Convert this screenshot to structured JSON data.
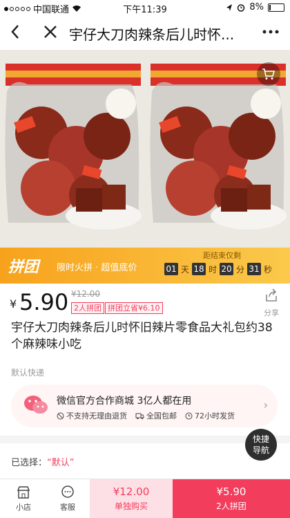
{
  "status_bar": {
    "carrier": "中国联通",
    "time": "下午11:39",
    "battery": "8%",
    "battery_level": 0.08
  },
  "nav": {
    "title": "宇仔大刀肉辣条后儿时怀..."
  },
  "promo": {
    "badge": "拼团",
    "subtitle": "限时火拼 · 超值底价",
    "countdown_title": "距结束仅剩",
    "countdown": [
      {
        "value": "01",
        "unit": "天"
      },
      {
        "value": "18",
        "unit": "时"
      },
      {
        "value": "20",
        "unit": "分"
      },
      {
        "value": "31",
        "unit": "秒"
      }
    ]
  },
  "price": {
    "currency": "¥",
    "current": "5.90",
    "original": "¥12.00",
    "tag_group": "2人拼团",
    "tag_save": "拼团立省¥6.10",
    "share_label": "分享"
  },
  "product": {
    "title": "宇仔大刀肉辣条后儿时怀旧辣片零食品大礼包约38个麻辣味小吃"
  },
  "delivery": {
    "label": "默认快递"
  },
  "shop": {
    "name": "微信官方合作商城   3亿人都在用",
    "features": [
      "不支持无理由退货",
      "全国包邮",
      "72小时发货"
    ]
  },
  "selection": {
    "label": "已选择：",
    "value": "“默认”"
  },
  "quick_nav": {
    "line1": "快捷",
    "line2": "导航"
  },
  "bottom": {
    "shop_label": "小店",
    "service_label": "客服",
    "solo_price": "¥12.00",
    "solo_label": "单独购买",
    "group_price": "¥5.90",
    "group_label": "2人拼团"
  },
  "colors": {
    "accent": "#f23d5c",
    "promo_start": "#f7a21c",
    "promo_end": "#fbc94b"
  }
}
